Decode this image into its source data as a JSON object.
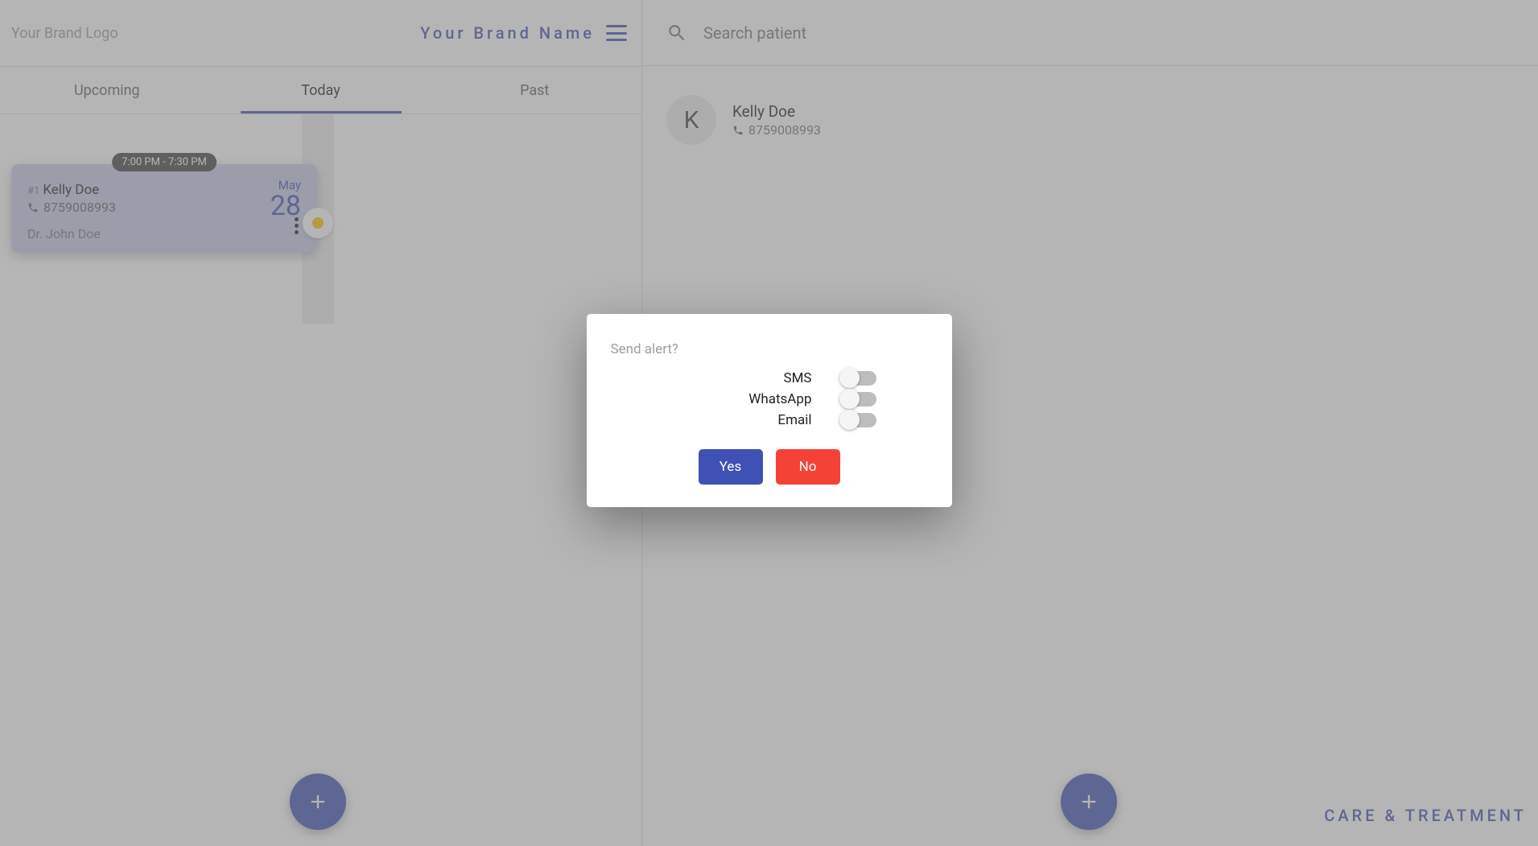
{
  "brand": {
    "logo_text": "Your Brand Logo",
    "name": "Your Brand Name"
  },
  "tabs": {
    "upcoming": "Upcoming",
    "today": "Today",
    "past": "Past",
    "active": "today"
  },
  "appointment": {
    "time_range": "7:00 PM - 7:30 PM",
    "index_label": "#1",
    "patient_name": "Kelly Doe",
    "phone": "8759008993",
    "doctor": "Dr. John Doe",
    "month": "May",
    "day": "28",
    "status_color": "#ffc107"
  },
  "patient": {
    "initial": "K",
    "name": "Kelly Doe",
    "phone": "8759008993"
  },
  "search": {
    "placeholder": "Search patient"
  },
  "footer": {
    "care_link": "CARE & TREATMENT"
  },
  "dialog": {
    "title": "Send alert?",
    "options": {
      "sms": "SMS",
      "whatsapp": "WhatsApp",
      "email": "Email"
    },
    "toggles": {
      "sms": false,
      "whatsapp": false,
      "email": false
    },
    "yes": "Yes",
    "no": "No"
  },
  "colors": {
    "primary": "#3f51b5",
    "danger": "#f44336",
    "warn": "#ffc107"
  }
}
